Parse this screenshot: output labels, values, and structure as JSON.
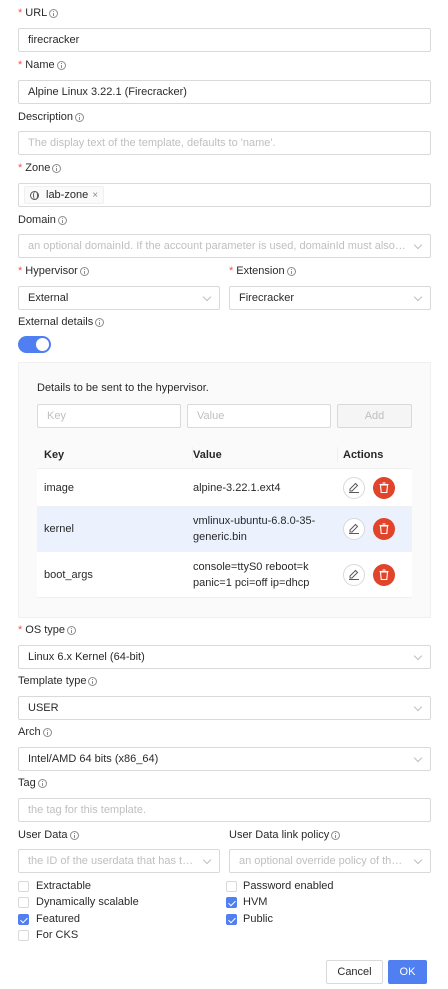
{
  "url": {
    "label": "URL",
    "value": "firecracker"
  },
  "name": {
    "label": "Name",
    "value": "Alpine Linux 3.22.1 (Firecracker)"
  },
  "description": {
    "label": "Description",
    "placeholder": "The display text of the template, defaults to 'name'."
  },
  "zone": {
    "label": "Zone",
    "tag": "lab-zone",
    "tag_close": "×"
  },
  "domain": {
    "label": "Domain",
    "placeholder": "an optional domainId. If the account parameter is used, domainId must also ..."
  },
  "hypervisor": {
    "label": "Hypervisor",
    "value": "External"
  },
  "extension": {
    "label": "Extension",
    "value": "Firecracker"
  },
  "external_details": {
    "label": "External details",
    "enabled": true,
    "panel_title": "Details to be sent to the hypervisor.",
    "key_placeholder": "Key",
    "value_placeholder": "Value",
    "add_label": "Add",
    "columns": [
      "Key",
      "Value",
      "Actions"
    ],
    "rows": [
      {
        "key": "image",
        "value_lines": [
          "alpine-3.22.1.ext4"
        ]
      },
      {
        "key": "kernel",
        "value_lines": [
          "vmlinux-ubuntu-6.8.0-35-",
          "generic.bin"
        ]
      },
      {
        "key": "boot_args",
        "value_lines": [
          "console=ttyS0 reboot=k",
          "panic=1 pci=off ip=dhcp"
        ]
      }
    ]
  },
  "os_type": {
    "label": "OS type",
    "value": "Linux 6.x Kernel (64-bit)"
  },
  "template_type": {
    "label": "Template type",
    "value": "USER"
  },
  "arch": {
    "label": "Arch",
    "value": "Intel/AMD 64 bits (x86_64)"
  },
  "tag": {
    "label": "Tag",
    "placeholder": "the tag for this template."
  },
  "user_data": {
    "label": "User Data",
    "placeholder": "the ID of the userdata that has to..."
  },
  "user_data_policy": {
    "label": "User Data link policy",
    "placeholder": "an optional override policy of the..."
  },
  "checkboxes": {
    "extractable": {
      "label": "Extractable",
      "checked": false
    },
    "dynamically_scalable": {
      "label": "Dynamically scalable",
      "checked": false
    },
    "featured": {
      "label": "Featured",
      "checked": true
    },
    "for_cks": {
      "label": "For CKS",
      "checked": false
    },
    "password_enabled": {
      "label": "Password enabled",
      "checked": false
    },
    "hvm": {
      "label": "HVM",
      "checked": true
    },
    "public": {
      "label": "Public",
      "checked": true
    }
  },
  "footer": {
    "cancel": "Cancel",
    "ok": "OK"
  },
  "colors": {
    "primary": "#4f7ff0",
    "danger": "#e0442a",
    "required": "#ff4d4f"
  }
}
